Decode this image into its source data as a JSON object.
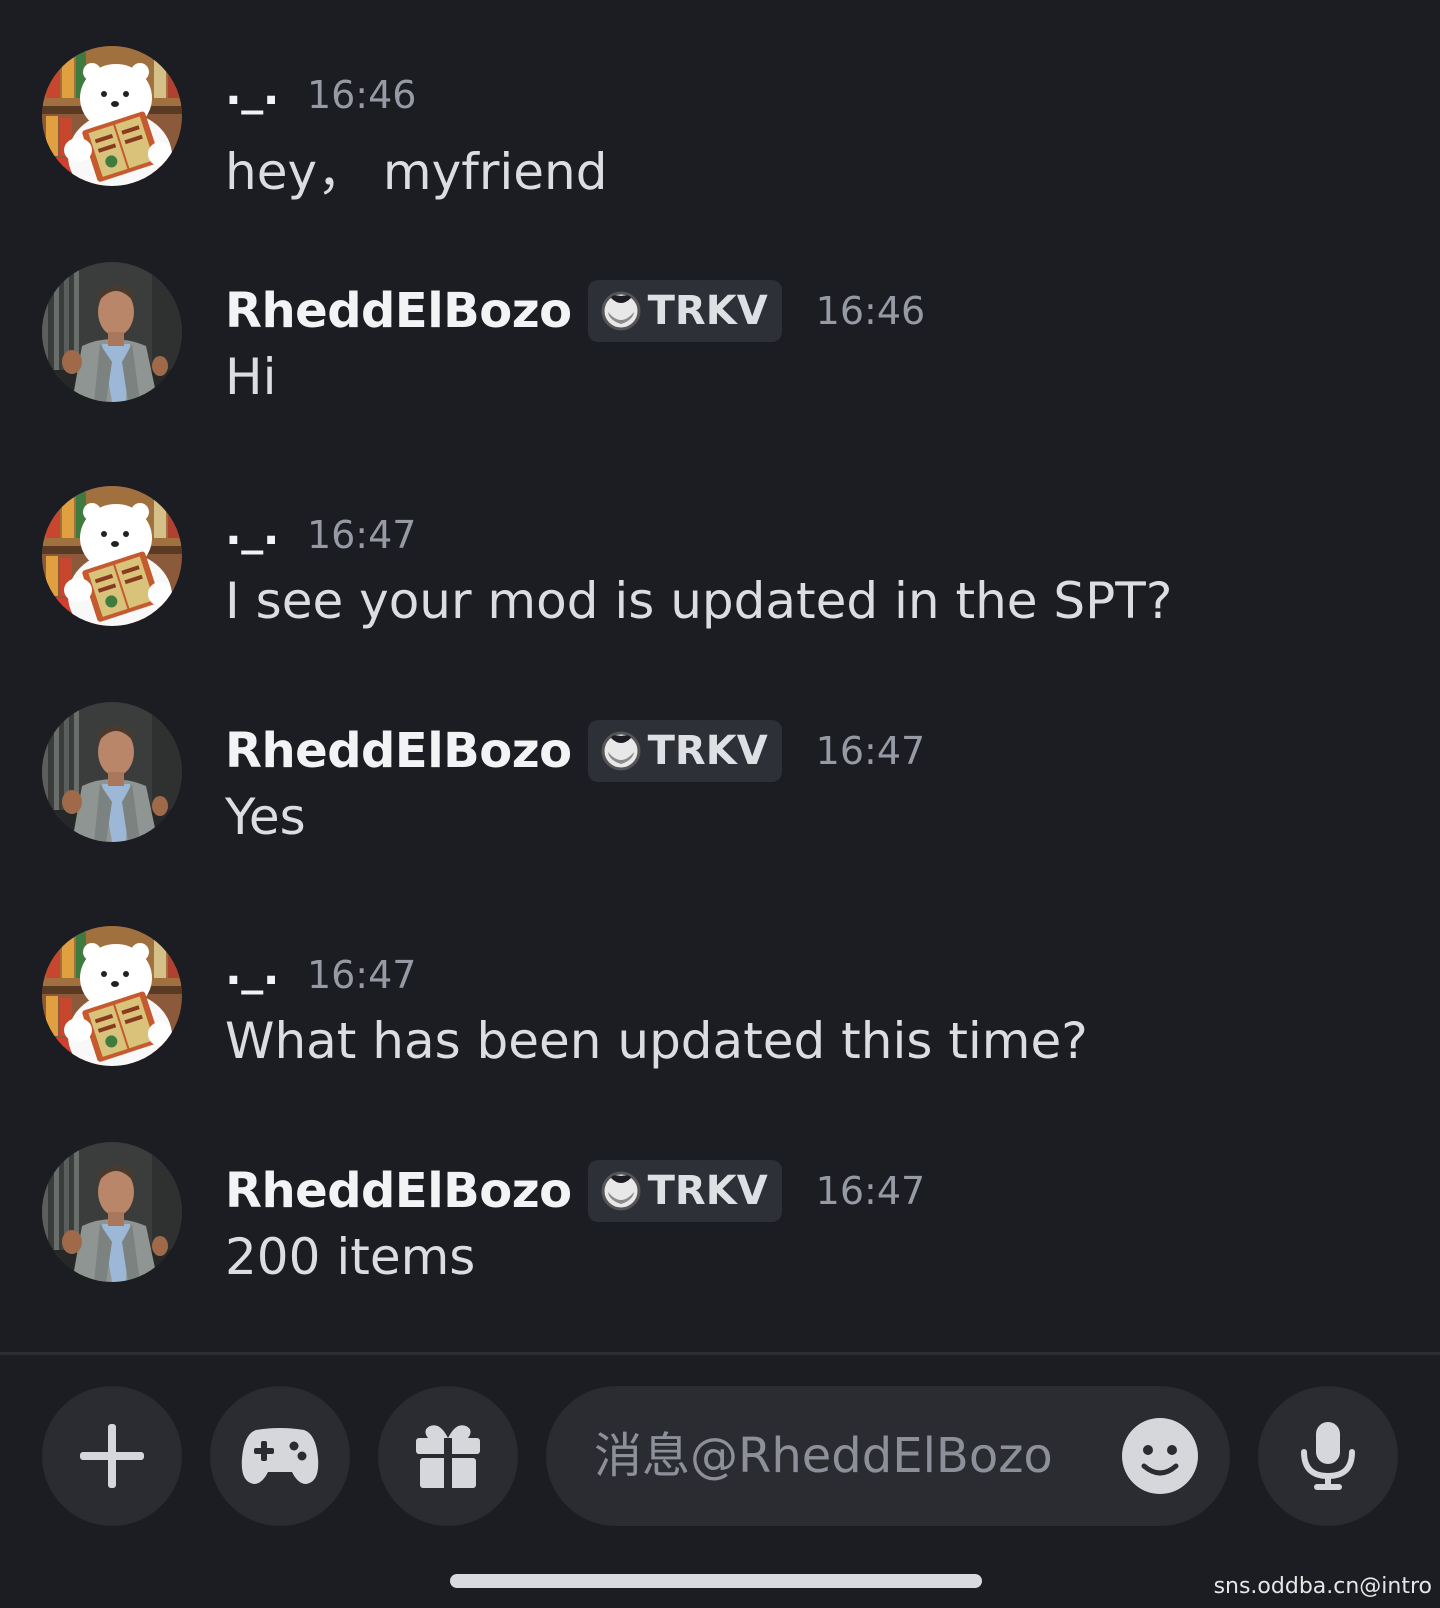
{
  "messages": [
    {
      "username": "._.",
      "time": "16:46",
      "text": "hey， myfriend",
      "has_tag": false
    },
    {
      "username": "RheddElBozo",
      "tag": "TRKV",
      "time": "16:46",
      "text": "Hi",
      "has_tag": true
    },
    {
      "username": "._.",
      "time": "16:47",
      "text": "I see your mod is updated in the SPT?",
      "has_tag": false
    },
    {
      "username": "RheddElBozo",
      "tag": "TRKV",
      "time": "16:47",
      "text": "Yes",
      "has_tag": true
    },
    {
      "username": "._.",
      "time": "16:47",
      "text": "What has been updated this time?",
      "has_tag": false
    },
    {
      "username": "RheddElBozo",
      "tag": "TRKV",
      "time": "16:47",
      "text": "200 items",
      "has_tag": true
    }
  ],
  "composer": {
    "placeholder": "消息@RheddElBozo",
    "buttons": [
      "plus-icon",
      "gamepad-icon",
      "gift-icon",
      "emoji-icon",
      "microphone-icon"
    ]
  },
  "watermark": "sns.oddba.cn@intro",
  "colors": {
    "background": "#1c1d22",
    "surface": "#2a2c32",
    "tag_background": "#2e3038",
    "text_primary": "#f2f3f5",
    "text_muted": "#959aa4"
  }
}
